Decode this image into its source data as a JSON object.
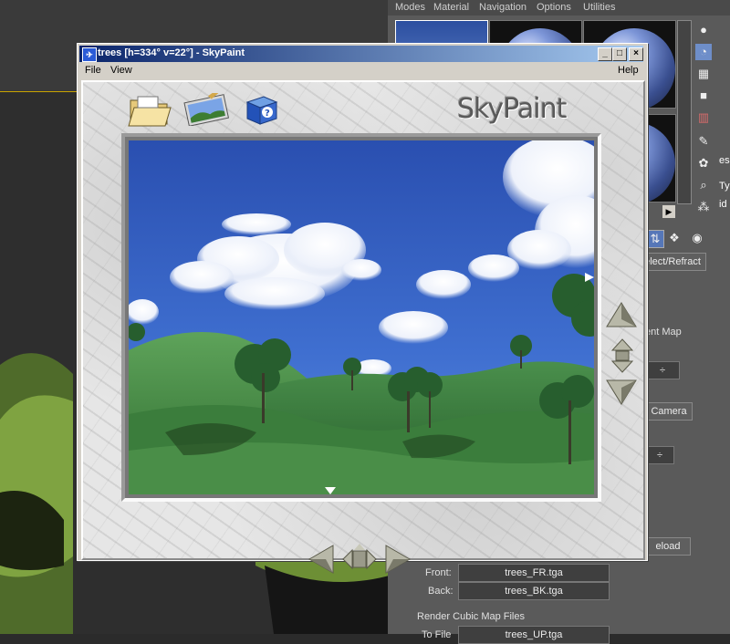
{
  "material_editor": {
    "menu": [
      "Modes",
      "Material",
      "Navigation",
      "Options",
      "Utilities"
    ],
    "panel": {
      "reflect_refract_label": "elect/Refract",
      "map_label": "ent Map",
      "camera_button": "Camera",
      "reload_button": "eload",
      "front_label": "Front:",
      "front_file": "trees_FR.tga",
      "back_label": "Back:",
      "back_file": "trees_BK.tga",
      "render_cubic_label": "Render Cubic Map Files",
      "to_file_label": "To File",
      "to_file_value": "trees_UP.tga"
    },
    "side_letters": [
      "es",
      "Ty",
      "id"
    ]
  },
  "skypaint": {
    "title": "trees [h=334° v=22°] - SkyPaint",
    "menus": {
      "file": "File",
      "view": "View",
      "help": "Help"
    },
    "logo_text": "SkyPaint",
    "toolbar_icons": [
      "folder-icon",
      "landscape-icon",
      "help-book-icon"
    ],
    "window_buttons": [
      "minimize",
      "maximize",
      "close"
    ]
  }
}
